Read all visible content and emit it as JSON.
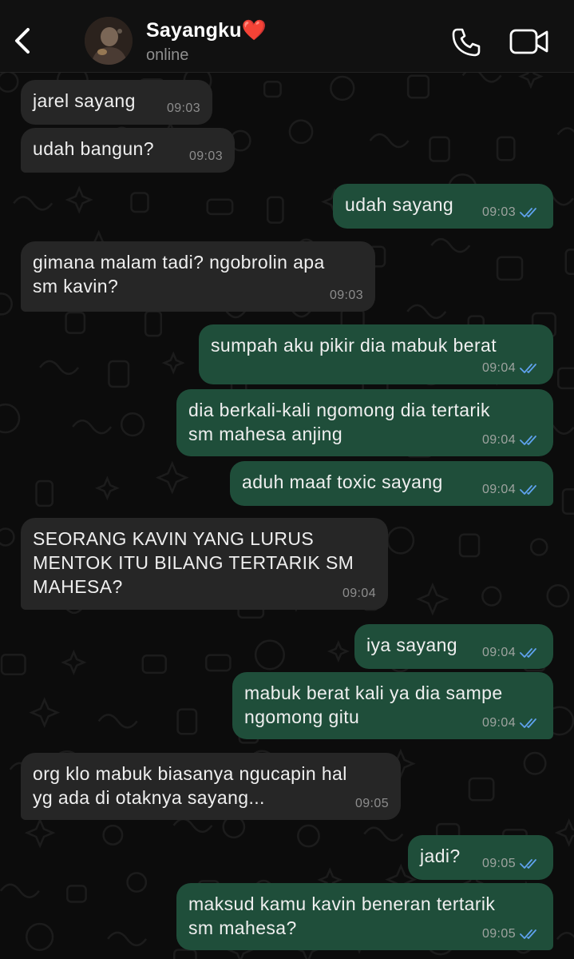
{
  "header": {
    "contact_name": "Sayangku❤️",
    "status": "online"
  },
  "messages": [
    {
      "dir": "in",
      "text": "jarel sayang",
      "time": "09:03"
    },
    {
      "dir": "in",
      "text": "udah bangun?",
      "time": "09:03"
    },
    {
      "dir": "out",
      "text": "udah sayang",
      "time": "09:03",
      "read": true
    },
    {
      "dir": "in",
      "text": "gimana malam tadi? ngobrolin apa\nsm kavin?",
      "time": "09:03"
    },
    {
      "dir": "out",
      "text": "sumpah aku pikir dia mabuk berat",
      "time": "09:04",
      "read": true
    },
    {
      "dir": "out",
      "text": "dia berkali-kali ngomong dia tertarik\nsm mahesa anjing",
      "time": "09:04",
      "read": true
    },
    {
      "dir": "out",
      "text": "aduh maaf toxic sayang",
      "time": "09:04",
      "read": true
    },
    {
      "dir": "in",
      "text": "SEORANG KAVIN YANG LURUS\nMENTOK ITU BILANG TERTARIK SM\nMAHESA?",
      "time": "09:04"
    },
    {
      "dir": "out",
      "text": "iya sayang",
      "time": "09:04",
      "read": true
    },
    {
      "dir": "out",
      "text": "mabuk berat kali ya dia sampe\nngomong gitu",
      "time": "09:04",
      "read": true
    },
    {
      "dir": "in",
      "text": "org klo mabuk biasanya ngucapin hal\nyg ada di otaknya sayang...",
      "time": "09:05"
    },
    {
      "dir": "out",
      "text": "jadi?",
      "time": "09:05",
      "read": true
    },
    {
      "dir": "out",
      "text": "maksud kamu kavin beneran tertarik\nsm mahesa?",
      "time": "09:05",
      "read": true
    }
  ],
  "colors": {
    "incoming_bubble": "#262626",
    "outgoing_bubble": "#1f4e3a",
    "read_tick": "#5fa2ee",
    "header_bg": "#111111"
  },
  "icons": [
    "chevron-left-icon",
    "phone-icon",
    "video-camera-icon",
    "double-check-icon"
  ]
}
